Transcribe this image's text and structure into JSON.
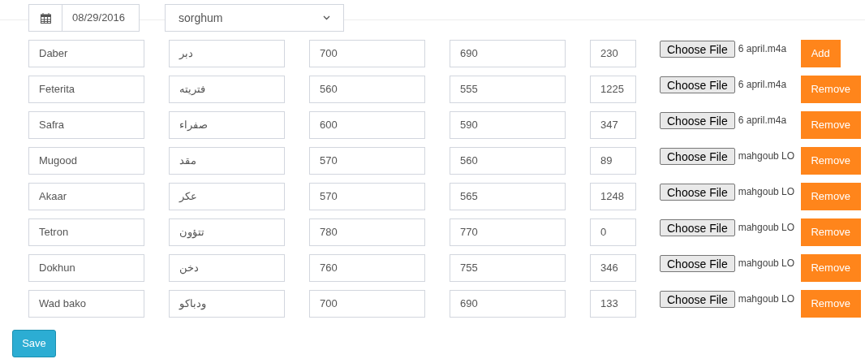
{
  "header": {
    "date": "08/29/2016",
    "crop_select": "sorghum"
  },
  "rows": [
    {
      "name": "Daber",
      "local_name": "دبر",
      "value_1": "700",
      "value_2": "690",
      "value_3": "230",
      "file_button": "Choose File",
      "file_name": "6 april.m4a",
      "action": {
        "kind": "add",
        "label": "Add"
      }
    },
    {
      "name": "Feterita",
      "local_name": "فتريته",
      "value_1": "560",
      "value_2": "555",
      "value_3": "1225",
      "file_button": "Choose File",
      "file_name": "6 april.m4a",
      "action": {
        "kind": "remove",
        "label": "Remove"
      }
    },
    {
      "name": "Safra",
      "local_name": "صفراء",
      "value_1": "600",
      "value_2": "590",
      "value_3": "347",
      "file_button": "Choose File",
      "file_name": "6 april.m4a",
      "action": {
        "kind": "remove",
        "label": "Remove"
      }
    },
    {
      "name": "Mugood",
      "local_name": "مقد",
      "value_1": "570",
      "value_2": "560",
      "value_3": "89",
      "file_button": "Choose File",
      "file_name": "mahgoub LO",
      "action": {
        "kind": "remove",
        "label": "Remove"
      }
    },
    {
      "name": "Akaar",
      "local_name": "عكر",
      "value_1": "570",
      "value_2": "565",
      "value_3": "1248",
      "file_button": "Choose File",
      "file_name": "mahgoub LO",
      "action": {
        "kind": "remove",
        "label": "Remove"
      }
    },
    {
      "name": "Tetron",
      "local_name": "تتؤون",
      "value_1": "780",
      "value_2": "770",
      "value_3": "0",
      "file_button": "Choose File",
      "file_name": "mahgoub LO",
      "action": {
        "kind": "remove",
        "label": "Remove"
      }
    },
    {
      "name": "Dokhun",
      "local_name": "دخن",
      "value_1": "760",
      "value_2": "755",
      "value_3": "346",
      "file_button": "Choose File",
      "file_name": "mahgoub LO",
      "action": {
        "kind": "remove",
        "label": "Remove"
      }
    },
    {
      "name": "Wad bako",
      "local_name": "ودباكو",
      "value_1": "700",
      "value_2": "690",
      "value_3": "133",
      "file_button": "Choose File",
      "file_name": "mahgoub LO",
      "action": {
        "kind": "remove",
        "label": "Remove"
      }
    }
  ],
  "save_button": "Save"
}
